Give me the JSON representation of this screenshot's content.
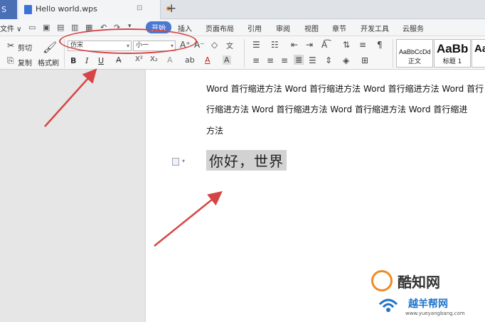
{
  "tabbar": {
    "app_label": "S",
    "doc_title": "Hello world.wps",
    "tab_sub": "⊡",
    "add_tab": "+"
  },
  "menu": {
    "file": "文件 ∨",
    "items": [
      "开始",
      "插入",
      "页面布局",
      "引用",
      "审阅",
      "视图",
      "章节",
      "开发工具",
      "云服务"
    ]
  },
  "ribbon": {
    "cut": "剪切",
    "copy": "复制",
    "format_painter": "格式刷",
    "font_name": "仿宋",
    "font_size": "小一",
    "bold": "B",
    "italic": "I",
    "underline": "U",
    "styles": [
      {
        "sample": "AaBbCcDd",
        "name": "正文"
      },
      {
        "sample": "AaBb",
        "name": "标题 1"
      },
      {
        "sample": "AaBb",
        "name": ""
      }
    ]
  },
  "document": {
    "line1": "Word 首行缩进方法 Word 首行缩进方法 Word 首行缩进方法 Word 首行",
    "line2": "行缩进方法 Word 首行缩进方法 Word 首行缩进方法 Word 首行缩进",
    "line3": "方法",
    "heading": "你好，世界"
  },
  "watermark": {
    "brand": "酷知网",
    "name": "越羊帮网",
    "url": "www.yueyangbang.com"
  },
  "colors": {
    "accent": "#4a78d2",
    "annotation": "#d64545",
    "watermark_orange": "#f08a24",
    "watermark_blue": "#1f73c9"
  }
}
